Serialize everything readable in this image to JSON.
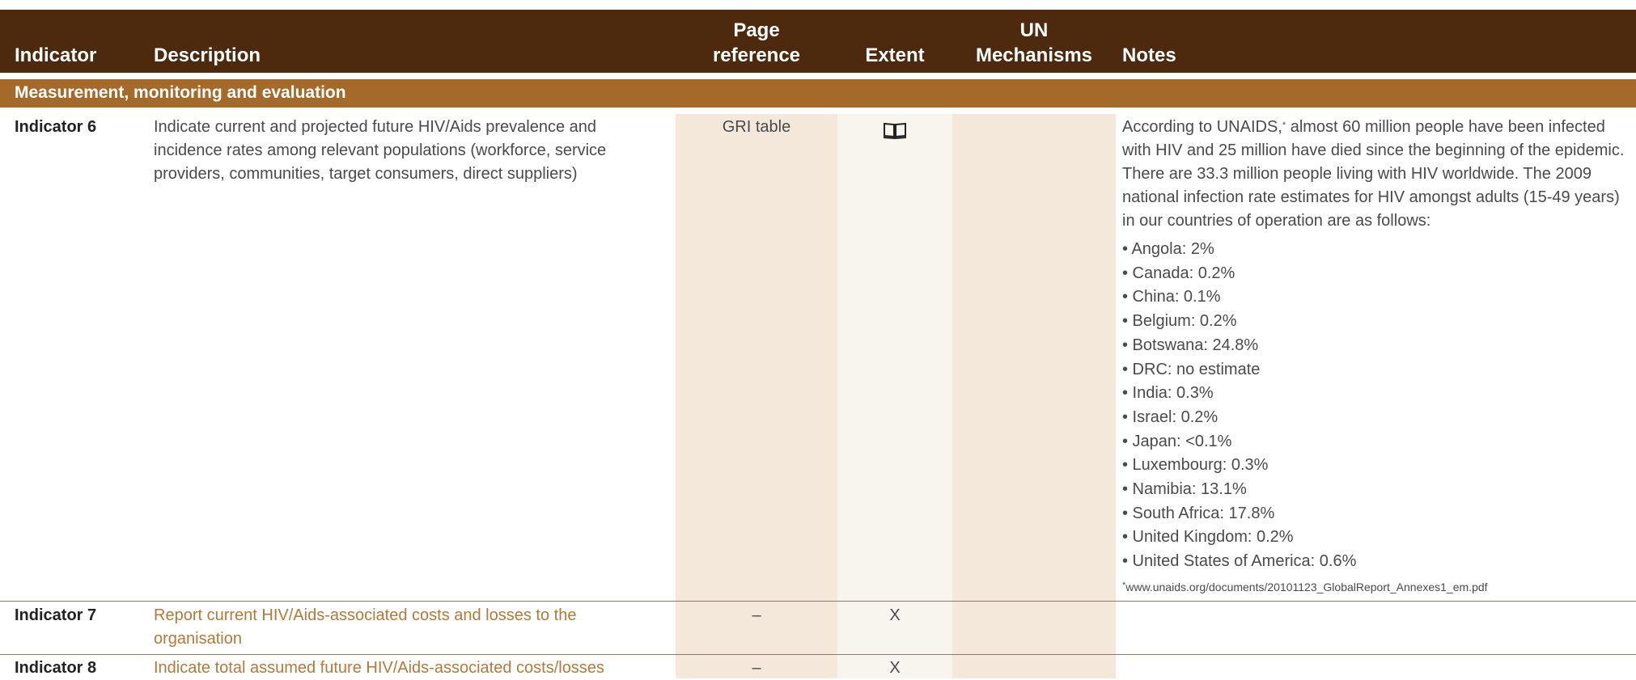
{
  "header": {
    "indicator": "Indicator",
    "description": "Description",
    "page_ref_line1": "Page",
    "page_ref_line2": "reference",
    "extent": "Extent",
    "un_line1": "UN",
    "un_line2": "Mechanisms",
    "notes": "Notes"
  },
  "section": {
    "title": "Measurement, monitoring and evaluation"
  },
  "rows": [
    {
      "indicator": "Indicator 6",
      "description": "Indicate current and projected future HIV/Aids prevalence and incidence rates among relevant populations (workforce, service providers, communities, target consumers, direct suppliers)",
      "page_reference": "GRI table",
      "extent_icon": "book-icon",
      "notes": {
        "intro_before": "According to UNAIDS,",
        "intro_mark": "*",
        "intro_after": " almost 60 million people have been infected with HIV and 25 million have died since the beginning of the epidemic. There are 33.3 million people living with HIV worldwide. The 2009 national infection rate estimates for HIV amongst adults (15-49 years) in our countries of operation are as follows:",
        "items": [
          "• Angola: 2%",
          "• Canada: 0.2%",
          "• China: 0.1%",
          "• Belgium: 0.2%",
          "• Botswana: 24.8%",
          "• DRC: no estimate",
          "• India: 0.3%",
          "• Israel: 0.2%",
          "• Japan: <0.1%",
          "• Luxembourg: 0.3%",
          "• Namibia: 13.1%",
          "• South Africa: 17.8%",
          "• United Kingdom: 0.2%",
          "• United States of America: 0.6%"
        ],
        "footnote_mark": "*",
        "footnote": "www.unaids.org/documents/20101123_GlobalReport_Annexes1_em.pdf"
      }
    },
    {
      "indicator": "Indicator 7",
      "description": "Report current HIV/Aids-associated costs and losses to the organisation",
      "page_reference": "–",
      "extent": "X"
    },
    {
      "indicator": "Indicator 8",
      "description": "Indicate total assumed future HIV/Aids-associated costs/losses",
      "page_reference": "–",
      "extent": "X"
    }
  ],
  "colors": {
    "header_bg": "#4d2a0d",
    "section_bg": "#a56a2a",
    "link_text": "#b07a3a",
    "column_shade": "#f3e8da"
  }
}
